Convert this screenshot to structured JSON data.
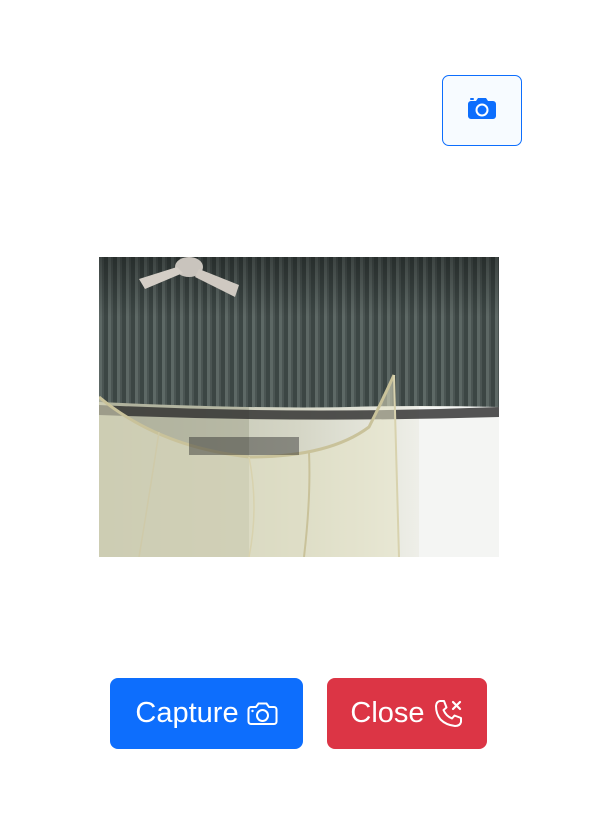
{
  "switch_camera": {
    "icon": "camera-flip-icon",
    "color": "#0d6efd"
  },
  "camera_preview": {
    "description_icon": "camera-feed"
  },
  "actions": {
    "capture_label": "Capture",
    "capture_icon": "camera-icon",
    "capture_color": "#0d6efd",
    "close_label": "Close",
    "close_icon": "phone-x-icon",
    "close_color": "#dc3545"
  }
}
